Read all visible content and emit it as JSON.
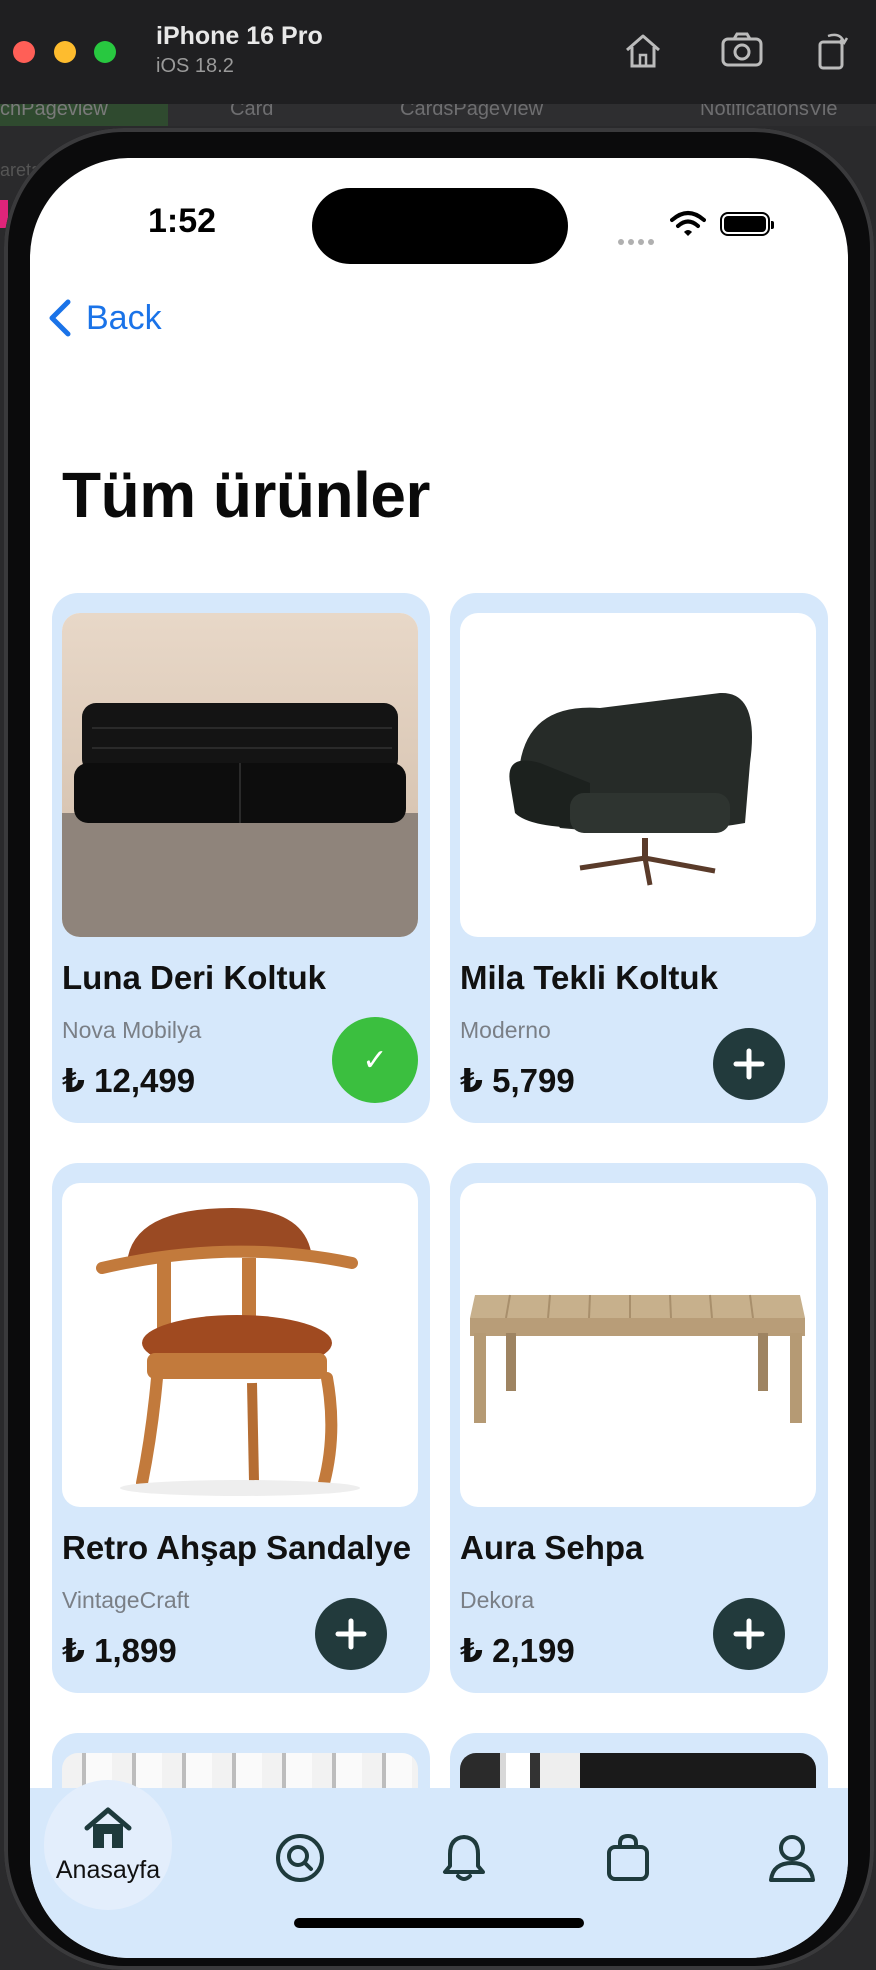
{
  "simulator": {
    "device_name": "iPhone 16 Pro",
    "os_version": "iOS 18.2",
    "xcode_tabs": [
      "chPageview",
      "Card",
      "CardsPageView",
      "NotificationsVie"
    ],
    "xcode_bg_label": "aretar"
  },
  "status_bar": {
    "time": "1:52"
  },
  "nav": {
    "back_label": "Back"
  },
  "page": {
    "title": "Tüm ürünler"
  },
  "products": [
    {
      "name": "Luna Deri Koltuk",
      "brand": "Nova Mobilya",
      "price": "₺ 12,499",
      "in_cart": true,
      "image": "black-leather-sofa"
    },
    {
      "name": "Mila Tekli Koltuk",
      "brand": "Moderno",
      "price": "₺ 5,799",
      "in_cart": false,
      "image": "dark-green-armchair"
    },
    {
      "name": "Retro Ahşap Sandalye",
      "brand": "VintageCraft",
      "price": "₺ 1,899",
      "in_cart": false,
      "image": "wooden-leather-chair"
    },
    {
      "name": "Aura Sehpa",
      "brand": "Dekora",
      "price": "₺ 2,199",
      "in_cart": false,
      "image": "wooden-coffee-table"
    }
  ],
  "tabbar": {
    "items": [
      {
        "label": "Anasayfa",
        "icon": "home-icon",
        "active": true
      },
      {
        "label": "",
        "icon": "search-icon"
      },
      {
        "label": "",
        "icon": "bell-icon"
      },
      {
        "label": "",
        "icon": "shopping-bag-icon"
      },
      {
        "label": "",
        "icon": "profile-icon"
      }
    ]
  },
  "colors": {
    "card_bg": "#d6e8fb",
    "add_button": "#223a3c",
    "in_cart_button": "#3bbf3f",
    "link_blue": "#1a73e8"
  }
}
